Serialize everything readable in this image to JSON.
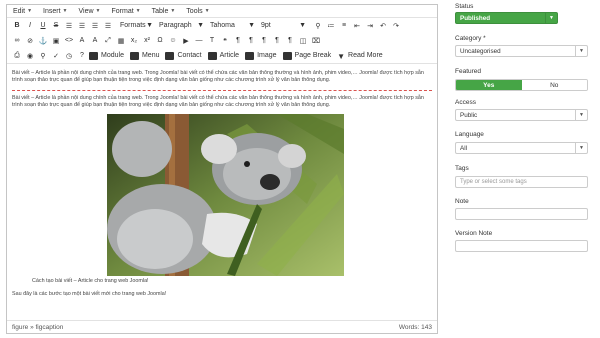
{
  "menubar": {
    "items": [
      "Edit",
      "Insert",
      "View",
      "Format",
      "Table",
      "Tools"
    ]
  },
  "toolbar": {
    "formats": "Formats",
    "paragraph": "Paragraph",
    "font": "Tahoma",
    "size": "9pt",
    "module": "Module",
    "menu": "Menu",
    "contact": "Contact",
    "article": "Article",
    "image": "Image",
    "page_break": "Page Break",
    "read_more": "Read More"
  },
  "content": {
    "para_top": "Bài viết – Article là phần nội dung chính của trang web. Trong Joomla! bài viết có thể chứa các văn bản thông thường và hình ảnh, phim video,… Joomla! được tích hợp sẵn trình soạn thảo trực quan để giúp bạn thuận tiện trong việc định dạng văn bản giống như các chương trình xử lý văn bản thông dụng.",
    "para_second": "Bài viết – Article là phần nội dung chính của trang web. Trong Joomla! bài viết có thể chứa các văn bản thông thường và hình ảnh, phim video,… Joomla! được tích hợp sẵn trình soạn thảo trực quan để giúp bạn thuận tiện trong việc định dạng văn bản giống như các chương trình xử lý văn bản thông dụng.",
    "caption": "Cách tạo bài viết – Article cho trang web Joomla!",
    "para_after": "Sau đây là các bước tạo một bài viết mới cho trang web Joomla!"
  },
  "statusbar": {
    "path": "figure » figcaption",
    "words": "Words: 143"
  },
  "sidebar": {
    "status_label": "Status",
    "status_value": "Published",
    "category_label": "Category *",
    "category_value": "Uncategorised",
    "featured_label": "Featured",
    "featured_yes": "Yes",
    "featured_no": "No",
    "access_label": "Access",
    "access_value": "Public",
    "language_label": "Language",
    "language_value": "All",
    "tags_label": "Tags",
    "tags_placeholder": "Type or select some tags",
    "note_label": "Note",
    "version_note_label": "Version Note"
  },
  "colors": {
    "published_green": "#46a546",
    "page_break_red": "#d9534f"
  }
}
